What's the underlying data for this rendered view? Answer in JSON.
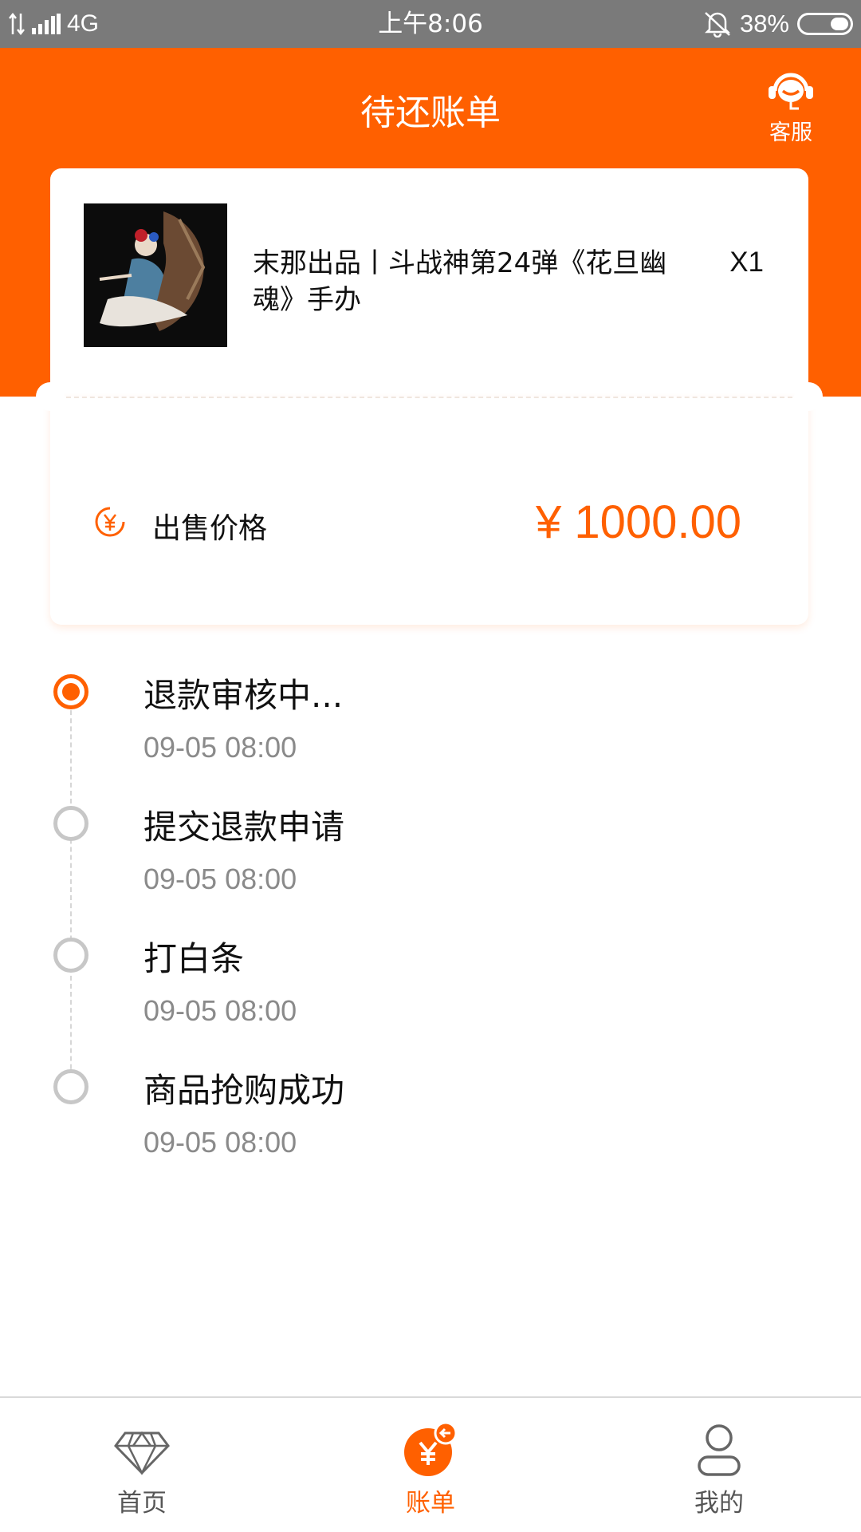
{
  "status_bar": {
    "network": "4G",
    "time": "上午8:06",
    "battery": "38%"
  },
  "header": {
    "title": "待还账单",
    "service_label": "客服"
  },
  "product": {
    "title": "末那出品丨斗战神第24弹《花旦幽魂》手办",
    "quantity": "X1"
  },
  "price": {
    "label": "出售价格",
    "value": "¥ 1000.00",
    "icon": "yen-icon"
  },
  "timeline": [
    {
      "title": "退款审核中...",
      "time": "09-05 08:00",
      "active": true
    },
    {
      "title": "提交退款申请",
      "time": "09-05 08:00",
      "active": false
    },
    {
      "title": "打白条",
      "time": "09-05 08:00",
      "active": false
    },
    {
      "title": "商品抢购成功",
      "time": "09-05 08:00",
      "active": false
    }
  ],
  "bottom_nav": [
    {
      "label": "首页",
      "icon": "diamond-icon",
      "active": false
    },
    {
      "label": "账单",
      "icon": "bill-yen-icon",
      "active": true
    },
    {
      "label": "我的",
      "icon": "user-icon",
      "active": false
    }
  ],
  "colors": {
    "accent": "#ff6000",
    "status_bar": "#7a7a7a",
    "inactive_dot": "#c7c7c7",
    "secondary_text": "#8a8a8a"
  }
}
